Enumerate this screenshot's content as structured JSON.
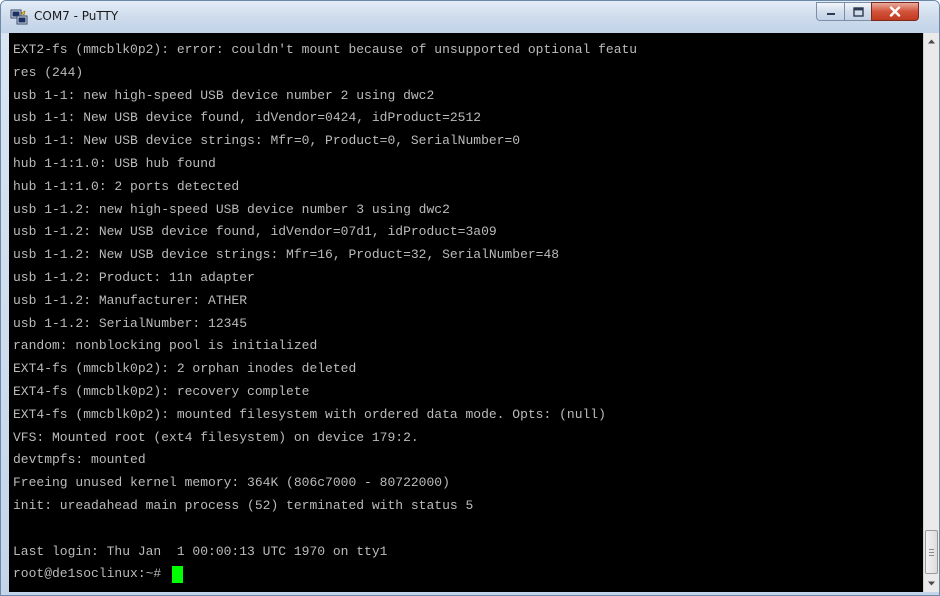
{
  "window": {
    "title": "COM7 - PuTTY",
    "icon": "putty-icon"
  },
  "controls": {
    "minimize_icon": "minimize-icon",
    "maximize_icon": "maximize-icon",
    "close_icon": "close-icon"
  },
  "terminal": {
    "lines": [
      "EXT2-fs (mmcblk0p2): error: couldn't mount because of unsupported optional featu",
      "res (244)",
      "usb 1-1: new high-speed USB device number 2 using dwc2",
      "usb 1-1: New USB device found, idVendor=0424, idProduct=2512",
      "usb 1-1: New USB device strings: Mfr=0, Product=0, SerialNumber=0",
      "hub 1-1:1.0: USB hub found",
      "hub 1-1:1.0: 2 ports detected",
      "usb 1-1.2: new high-speed USB device number 3 using dwc2",
      "usb 1-1.2: New USB device found, idVendor=07d1, idProduct=3a09",
      "usb 1-1.2: New USB device strings: Mfr=16, Product=32, SerialNumber=48",
      "usb 1-1.2: Product: 11n adapter",
      "usb 1-1.2: Manufacturer: ATHER",
      "usb 1-1.2: SerialNumber: 12345",
      "random: nonblocking pool is initialized",
      "EXT4-fs (mmcblk0p2): 2 orphan inodes deleted",
      "EXT4-fs (mmcblk0p2): recovery complete",
      "EXT4-fs (mmcblk0p2): mounted filesystem with ordered data mode. Opts: (null)",
      "VFS: Mounted root (ext4 filesystem) on device 179:2.",
      "devtmpfs: mounted",
      "Freeing unused kernel memory: 364K (806c7000 - 80722000)",
      "init: ureadahead main process (52) terminated with status 5",
      "",
      "Last login: Thu Jan  1 00:00:13 UTC 1970 on tty1"
    ],
    "prompt": "root@de1soclinux:~# ",
    "cursor_color": "#00ff00",
    "text_color": "#bbbbbb",
    "background": "#000000"
  },
  "scrollbar": {
    "up_icon": "scroll-up-arrow-icon",
    "down_icon": "scroll-down-arrow-icon"
  }
}
